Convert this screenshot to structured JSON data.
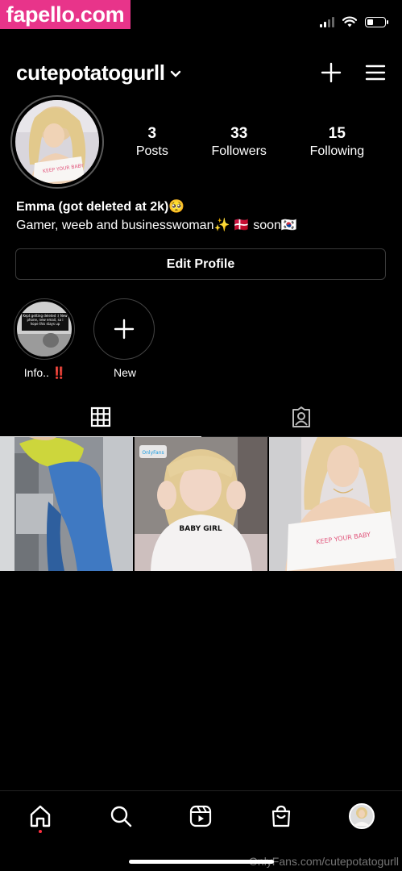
{
  "watermark": {
    "top": "fapello.com",
    "bottom": "OnlyFans.com/cutepotatogurll"
  },
  "status_bar": {
    "battery_level": 0.3
  },
  "header": {
    "username": "cutepotatogurll"
  },
  "stats": [
    {
      "value": "3",
      "label": "Posts"
    },
    {
      "value": "33",
      "label": "Followers"
    },
    {
      "value": "15",
      "label": "Following"
    }
  ],
  "bio": {
    "name": "Emma (got deleted at 2k)🥺",
    "line2": "Gamer, weeb and businesswoman✨  🇩🇰 soon🇰🇷"
  },
  "edit_profile_label": "Edit Profile",
  "highlights": [
    {
      "label": "Info.. ‼️",
      "thumb_text": "Kept getting deleted :( New phone, new email, so i hope this stays up"
    },
    {
      "label": "New"
    }
  ],
  "posts": [
    {
      "caption": "",
      "overlay": ""
    },
    {
      "caption": "BABY GIRL",
      "overlay": "OnlyFans"
    },
    {
      "caption": "KEEP YOUR BABY",
      "overlay": ""
    }
  ],
  "avatar_caption": "KEEP YOUR BABY",
  "colors": {
    "accent": "#e8348a",
    "notification_dot": "#ff3040",
    "background": "#000000",
    "divider": "#222222"
  },
  "icons": [
    "plus-icon",
    "menu-icon",
    "grid-icon",
    "tagged-icon",
    "home-icon",
    "search-icon",
    "reels-icon",
    "shop-icon"
  ]
}
